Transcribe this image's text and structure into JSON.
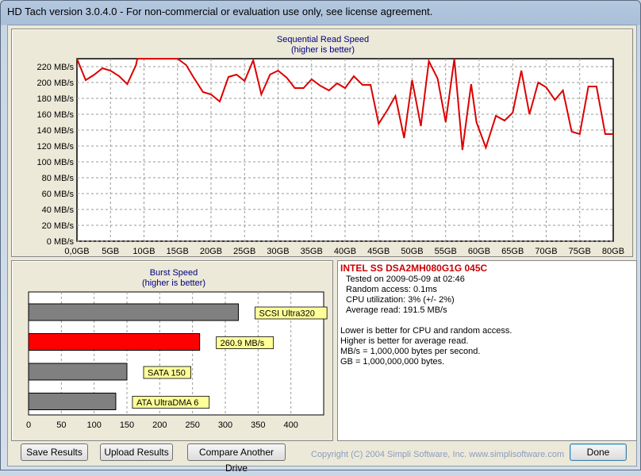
{
  "window": {
    "title": "HD Tach version 3.0.4.0  - For non-commercial or evaluation use only, see license agreement."
  },
  "sequential_chart": {
    "title": "Sequential Read Speed",
    "subtitle": "(higher is better)"
  },
  "burst_chart": {
    "title": "Burst Speed",
    "subtitle": "(higher is better)"
  },
  "info": {
    "device": "INTEL SS DSA2MH080G1G 045C",
    "tested_on": "Tested on 2009-05-09 at 02:46",
    "random_access": "Random access: 0.1ms",
    "cpu": "CPU utilization: 3% (+/- 2%)",
    "average_read": "Average read: 191.5 MB/s",
    "notes": [
      "Lower is better for CPU and random access.",
      "Higher is better for average read.",
      "MB/s = 1,000,000 bytes per second.",
      "GB = 1,000,000,000 bytes."
    ]
  },
  "buttons": {
    "save": "Save Results",
    "upload": "Upload Results",
    "compare": "Compare Another Drive",
    "done": "Done"
  },
  "copyright": "Copyright (C) 2004 Simpli Software, Inc. www.simplisoftware.com",
  "colors": {
    "line": "#dd0000",
    "burst_highlight": "#ff0000",
    "burst_ref": "#808080",
    "label_bg": "#ffff99"
  },
  "chart_data": [
    {
      "type": "line",
      "title": "Sequential Read Speed",
      "subtitle": "(higher is better)",
      "xlabel": "",
      "ylabel": "",
      "xlim": [
        0,
        80
      ],
      "ylim": [
        0,
        230
      ],
      "x_ticks": [
        "0,0GB",
        "5GB",
        "10GB",
        "15GB",
        "20GB",
        "25GB",
        "30GB",
        "35GB",
        "40GB",
        "45GB",
        "50GB",
        "55GB",
        "60GB",
        "65GB",
        "70GB",
        "75GB",
        "80GB"
      ],
      "y_ticks": [
        "0 MB/s",
        "20 MB/s",
        "40 MB/s",
        "60 MB/s",
        "80 MB/s",
        "100 MB/s",
        "120 MB/s",
        "140 MB/s",
        "160 MB/s",
        "180 MB/s",
        "200 MB/s",
        "220 MB/s"
      ],
      "y_tick_values": [
        0,
        20,
        40,
        60,
        80,
        100,
        120,
        140,
        160,
        180,
        200,
        220
      ],
      "grid": true,
      "x": [
        0,
        1.3,
        2.6,
        3.8,
        5,
        6.3,
        7.5,
        8.8,
        9,
        10,
        11,
        12,
        13,
        14,
        15,
        16.3,
        17.5,
        18.8,
        20,
        21.3,
        22.6,
        23.8,
        25,
        26.3,
        27.5,
        28.8,
        30,
        31.3,
        32.5,
        33.8,
        35,
        36.3,
        37.6,
        38.8,
        40,
        41.3,
        42.6,
        43.8,
        45,
        46.3,
        47.5,
        48.8,
        50,
        51.3,
        52.5,
        53.8,
        55,
        56.3,
        57.5,
        58.8,
        59.6,
        61,
        62.5,
        63.8,
        65,
        66.3,
        67.5,
        68.8,
        70,
        71.3,
        72.5,
        73.8,
        75,
        76.3,
        77.5,
        78.8,
        80
      ],
      "values": [
        230,
        203,
        210,
        218,
        215,
        208,
        198,
        222,
        230,
        230,
        230,
        230,
        230,
        230,
        230,
        222,
        205,
        188,
        185,
        176,
        207,
        210,
        202,
        228,
        185,
        210,
        215,
        206,
        193,
        193,
        204,
        196,
        190,
        199,
        193,
        208,
        197,
        197,
        148,
        165,
        183,
        130,
        203,
        145,
        227,
        205,
        150,
        230,
        115,
        198,
        150,
        118,
        158,
        152,
        162,
        215,
        160,
        200,
        194,
        178,
        190,
        138,
        135,
        195,
        195,
        135,
        135
      ]
    },
    {
      "type": "bar",
      "title": "Burst Speed",
      "subtitle": "(higher is better)",
      "orientation": "horizontal",
      "xlim": [
        0,
        450
      ],
      "x_ticks": [
        0,
        50,
        100,
        150,
        200,
        250,
        300,
        350,
        400
      ],
      "categories": [
        "SCSI Ultra320",
        "260.9 MB/s",
        "SATA 150",
        "ATA UltraDMA 6"
      ],
      "values": [
        320,
        260.9,
        150,
        133
      ],
      "highlight_index": 1
    }
  ]
}
